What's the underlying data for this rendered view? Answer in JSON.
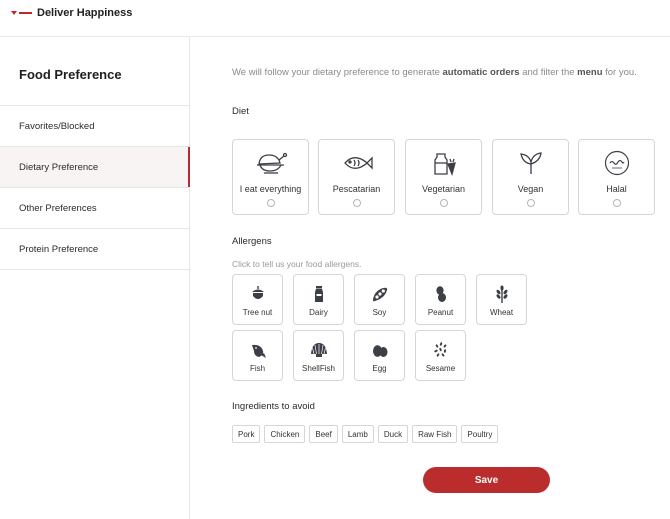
{
  "app": {
    "title": "Deliver Happiness",
    "logo_icon": "brand-logo-icon"
  },
  "sidebar": {
    "title": "Food Preference",
    "items": [
      {
        "label": "Favorites/Blocked"
      },
      {
        "label": "Dietary Preference",
        "active": true
      },
      {
        "label": "Other Preferences"
      },
      {
        "label": "Protein Preference"
      }
    ]
  },
  "intro": {
    "prefix": "We will follow your dietary preference to generate ",
    "bold1": "automatic orders",
    "middle": " and filter the ",
    "bold2": "menu",
    "suffix": " for you."
  },
  "diet": {
    "label": "Diet",
    "options": [
      {
        "label": "I eat everything",
        "icon": "roast-chicken-icon",
        "selected": false
      },
      {
        "label": "Pescatarian",
        "icon": "fish-icon",
        "selected": false
      },
      {
        "label": "Vegetarian",
        "icon": "milk-carrot-icon",
        "selected": false
      },
      {
        "label": "Vegan",
        "icon": "sprout-icon",
        "selected": false
      },
      {
        "label": "Halal",
        "icon": "halal-icon",
        "selected": false
      }
    ]
  },
  "allergens": {
    "label": "Allergens",
    "hint": "Click to tell us your food allergens.",
    "items": [
      {
        "label": "Tree nut",
        "icon": "acorn-icon"
      },
      {
        "label": "Dairy",
        "icon": "milk-bottle-icon"
      },
      {
        "label": "Soy",
        "icon": "soybean-icon"
      },
      {
        "label": "Peanut",
        "icon": "peanut-icon"
      },
      {
        "label": "Wheat",
        "icon": "wheat-icon"
      },
      {
        "label": "Fish",
        "icon": "fish-allergen-icon"
      },
      {
        "label": "ShellFish",
        "icon": "shell-icon"
      },
      {
        "label": "Egg",
        "icon": "egg-icon"
      },
      {
        "label": "Sesame",
        "icon": "sesame-icon"
      }
    ]
  },
  "ingredients": {
    "label": "Ingredients to avoid",
    "tags": [
      "Pork",
      "Chicken",
      "Beef",
      "Lamb",
      "Duck",
      "Raw Fish",
      "Poultry"
    ]
  },
  "actions": {
    "save_label": "Save"
  },
  "colors": {
    "accent": "#bb2d2d",
    "icon": "#3d3f47",
    "border": "#d6d6d6"
  }
}
